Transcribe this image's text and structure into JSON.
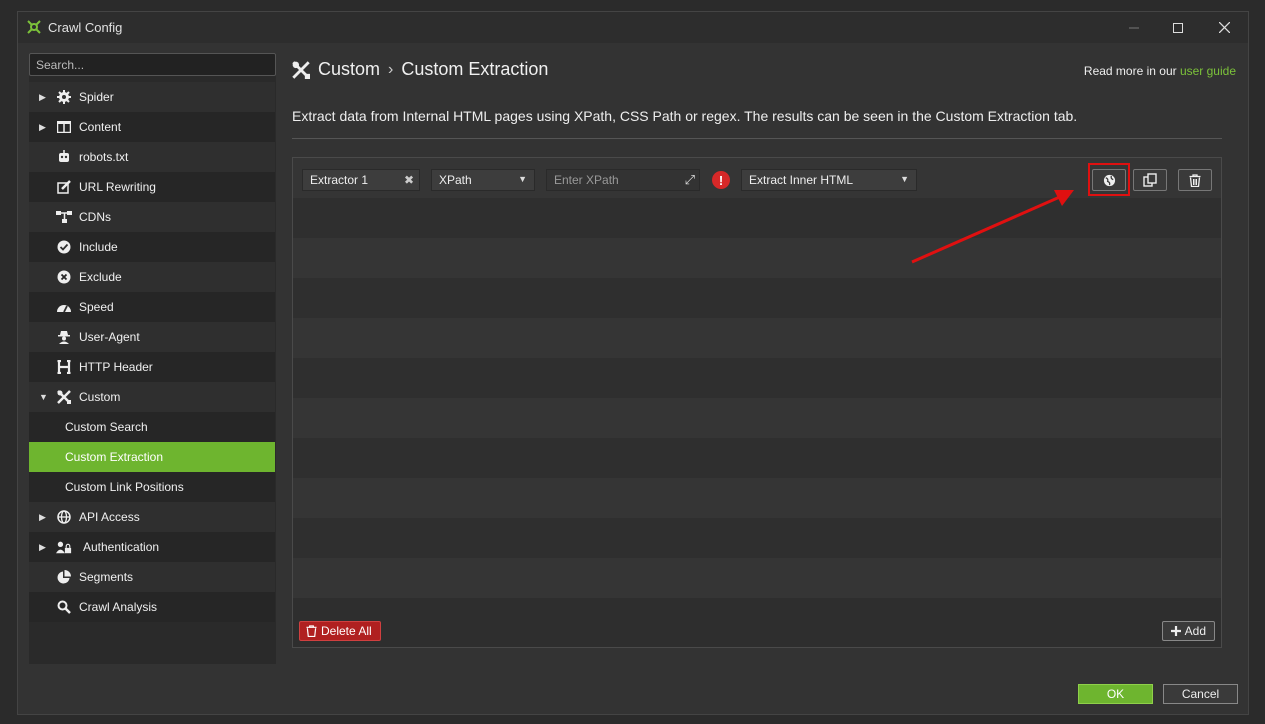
{
  "window": {
    "title": "Crawl Config"
  },
  "sidebar": {
    "search_placeholder": "Search...",
    "items": [
      {
        "label": "Spider",
        "arrow": "▶"
      },
      {
        "label": "Content",
        "arrow": "▶"
      },
      {
        "label": "robots.txt"
      },
      {
        "label": "URL Rewriting"
      },
      {
        "label": "CDNs"
      },
      {
        "label": "Include"
      },
      {
        "label": "Exclude"
      },
      {
        "label": "Speed"
      },
      {
        "label": "User-Agent"
      },
      {
        "label": "HTTP Header"
      },
      {
        "label": "Custom",
        "arrow": "▼"
      },
      {
        "label": "Custom Search"
      },
      {
        "label": "Custom Extraction"
      },
      {
        "label": "Custom Link Positions"
      },
      {
        "label": "API Access",
        "arrow": "▶"
      },
      {
        "label": "Authentication",
        "arrow": "▶"
      },
      {
        "label": "Segments"
      },
      {
        "label": "Crawl Analysis"
      }
    ]
  },
  "header": {
    "crumb_parent": "Custom",
    "crumb_sep": "›",
    "crumb_current": "Custom Extraction",
    "readmore_prefix": "Read more in our ",
    "readmore_link": "user guide",
    "description": "Extract data from Internal HTML pages using XPath, CSS Path or regex. The results can be seen in the Custom Extraction tab."
  },
  "extractor": {
    "name": "Extractor 1",
    "type": "XPath",
    "expression_placeholder": "Enter XPath",
    "mode": "Extract Inner HTML"
  },
  "footer": {
    "delete_all": "Delete All",
    "add": "Add"
  },
  "dialog": {
    "ok": "OK",
    "cancel": "Cancel"
  },
  "colors": {
    "accent": "#6eb52f",
    "danger": "#b02020",
    "annotation": "#e01010"
  }
}
